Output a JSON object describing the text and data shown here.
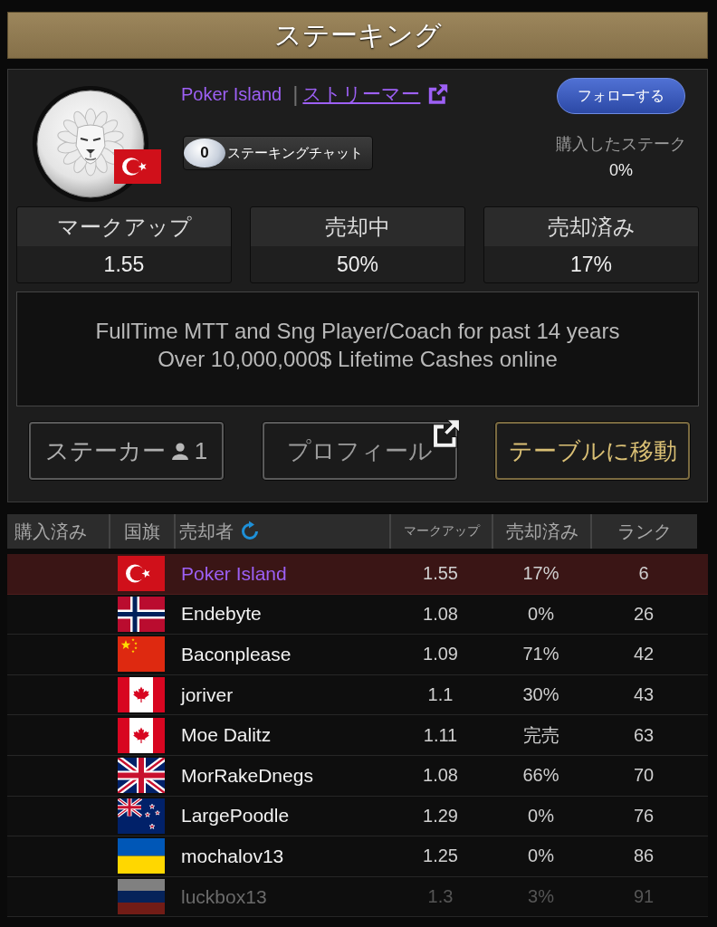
{
  "title": "ステーキング",
  "profile": {
    "flag": {
      "kind": "turkey"
    },
    "name": "Poker Island",
    "separator": "|",
    "link": "ストリーマー",
    "follow_button": "フォローする",
    "chat": {
      "count": "0",
      "label": "ステーキングチャット"
    },
    "purchased_label": "購入したステーク",
    "purchased_value": "0%"
  },
  "stats": [
    {
      "label": "マークアップ",
      "value": "1.55"
    },
    {
      "label": "売却中",
      "value": "50%"
    },
    {
      "label": "売却済み",
      "value": "17%"
    }
  ],
  "description": [
    "FullTime MTT and Sng Player/Coach for past 14 years",
    "Over 10,000,000$ Lifetime Cashes online"
  ],
  "actions": [
    {
      "kind": "stakers",
      "label": "ステーカー",
      "count": "1"
    },
    {
      "kind": "profile",
      "label": "プロフィール"
    },
    {
      "kind": "table",
      "label": "テーブルに移動"
    }
  ],
  "table": {
    "columns": [
      "購入済み",
      "国旗",
      "売却者",
      "マークアップ",
      "売却済み",
      "ランク"
    ],
    "rows": [
      {
        "flag": {
          "kind": "turkey"
        },
        "seller": "Poker Island",
        "markup": "1.55",
        "sold": "17%",
        "rank": "6",
        "selected": true,
        "dimmed": false
      },
      {
        "flag": {
          "kind": "norway"
        },
        "seller": "Endebyte",
        "markup": "1.08",
        "sold": "0%",
        "rank": "26",
        "selected": false,
        "dimmed": false
      },
      {
        "flag": {
          "kind": "china"
        },
        "seller": "Baconplease",
        "markup": "1.09",
        "sold": "71%",
        "rank": "42",
        "selected": false,
        "dimmed": false
      },
      {
        "flag": {
          "kind": "canada"
        },
        "seller": "joriver",
        "markup": "1.1",
        "sold": "30%",
        "rank": "43",
        "selected": false,
        "dimmed": false
      },
      {
        "flag": {
          "kind": "canada"
        },
        "seller": "Moe Dalitz",
        "markup": "1.11",
        "sold": "完売",
        "rank": "63",
        "selected": false,
        "dimmed": false
      },
      {
        "flag": {
          "kind": "uk"
        },
        "seller": "MorRakeDnegs",
        "markup": "1.08",
        "sold": "66%",
        "rank": "70",
        "selected": false,
        "dimmed": false
      },
      {
        "flag": {
          "kind": "new_zealand"
        },
        "seller": "LargePoodle",
        "markup": "1.29",
        "sold": "0%",
        "rank": "76",
        "selected": false,
        "dimmed": false
      },
      {
        "flag": {
          "kind": "ukraine"
        },
        "seller": "mochalov13",
        "markup": "1.25",
        "sold": "0%",
        "rank": "86",
        "selected": false,
        "dimmed": false
      },
      {
        "flag": {
          "kind": "russia"
        },
        "seller": "luckbox13",
        "markup": "1.3",
        "sold": "3%",
        "rank": "91",
        "selected": false,
        "dimmed": true
      }
    ]
  }
}
